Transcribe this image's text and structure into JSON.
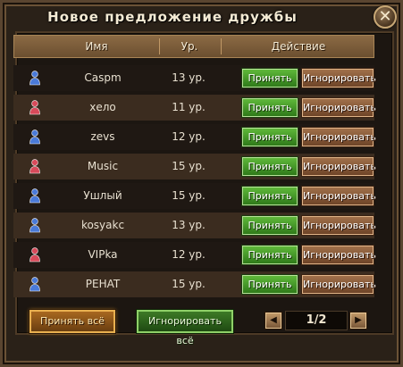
{
  "title": "Новое предложение дружбы",
  "close_icon": "close-icon",
  "columns": {
    "name": "Имя",
    "level": "Ур.",
    "action": "Действие"
  },
  "rows": [
    {
      "name": "Caspm",
      "level": "13 ур.",
      "gender": "male",
      "accept": "Принять",
      "ignore": "Игнорировать"
    },
    {
      "name": "хело",
      "level": "11 ур.",
      "gender": "female",
      "accept": "Принять",
      "ignore": "Игнорировать"
    },
    {
      "name": "zevs",
      "level": "12 ур.",
      "gender": "male",
      "accept": "Принять",
      "ignore": "Игнорировать"
    },
    {
      "name": "Music",
      "level": "15 ур.",
      "gender": "female",
      "accept": "Принять",
      "ignore": "Игнорировать"
    },
    {
      "name": "Ушлый",
      "level": "15 ур.",
      "gender": "male",
      "accept": "Принять",
      "ignore": "Игнорировать"
    },
    {
      "name": "kosyakc",
      "level": "13 ур.",
      "gender": "male",
      "accept": "Принять",
      "ignore": "Игнорировать"
    },
    {
      "name": "VIPka",
      "level": "12 ур.",
      "gender": "female",
      "accept": "Принять",
      "ignore": "Игнорировать"
    },
    {
      "name": "PEHAT",
      "level": "15 ур.",
      "gender": "male",
      "accept": "Принять",
      "ignore": "Игнорировать"
    }
  ],
  "footer": {
    "accept_all": "Принять всё",
    "ignore_all": "Игнорировать всё",
    "page": "1/2",
    "prev_icon": "arrow-left-icon",
    "next_icon": "arrow-right-icon"
  },
  "colors": {
    "male_avatar": "#4a7ad8",
    "female_avatar": "#d84a5a",
    "accept_button": "#3f9a26",
    "ignore_button": "#8a5a36"
  }
}
